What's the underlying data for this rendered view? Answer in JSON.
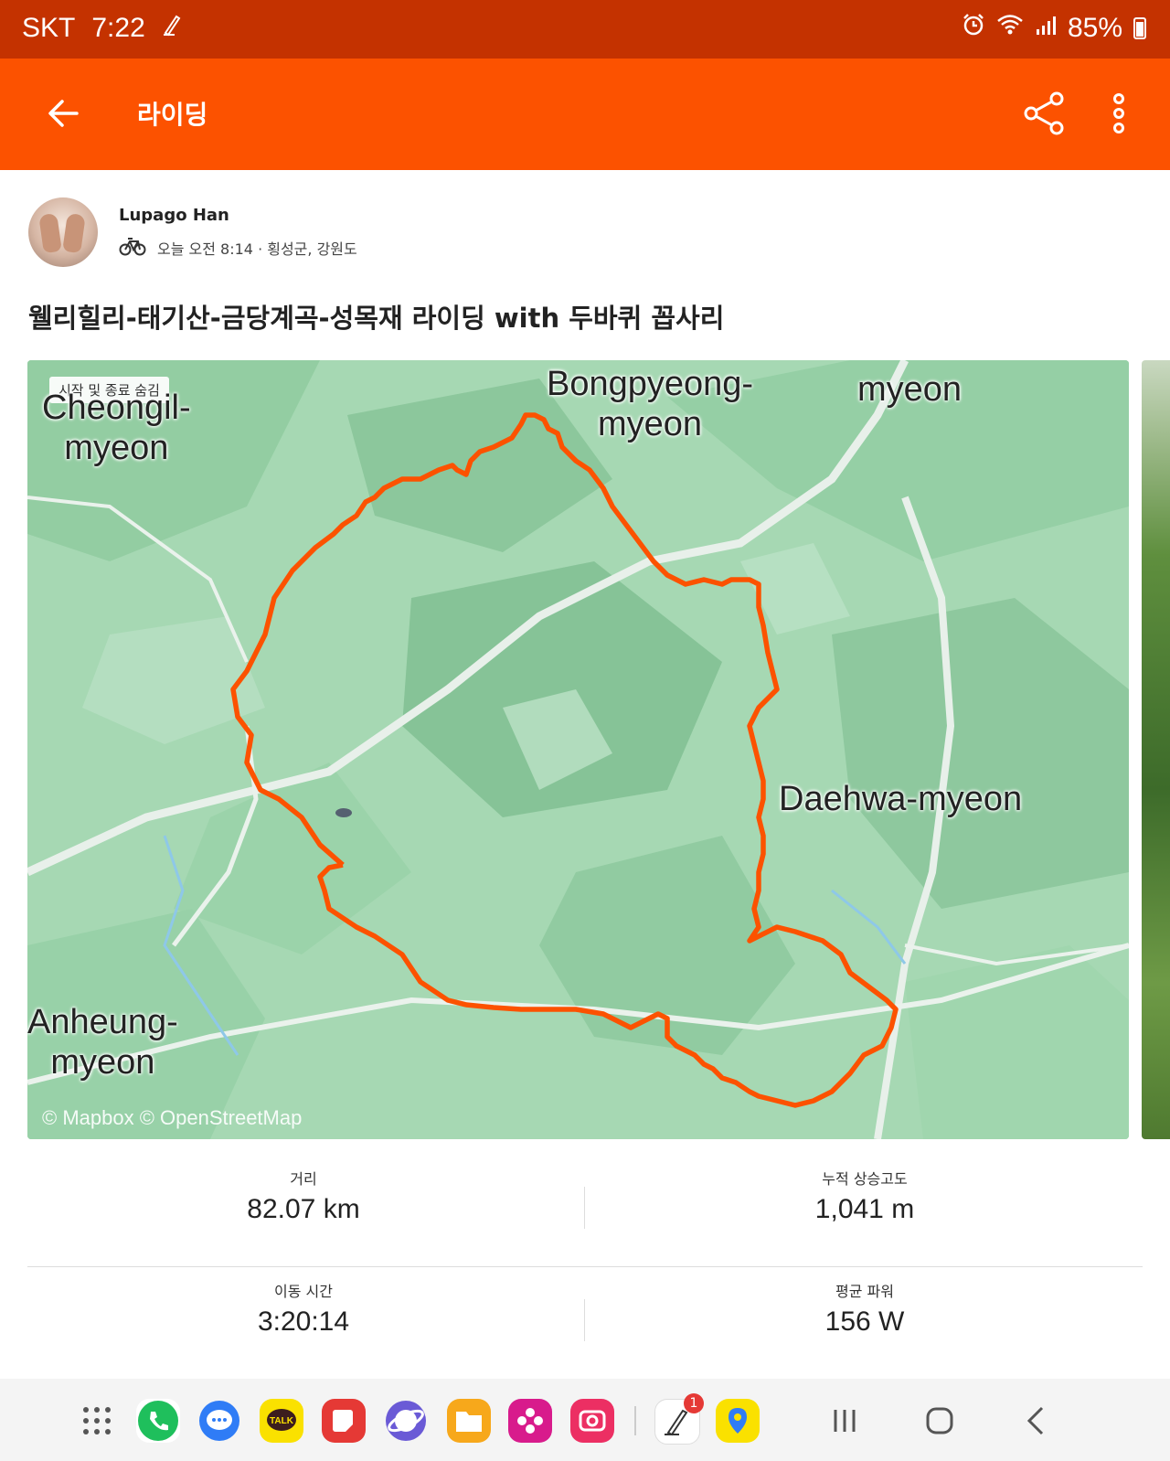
{
  "status_bar": {
    "carrier": "SKT",
    "time": "7:22",
    "battery": "85%"
  },
  "app_bar": {
    "title": "라이딩"
  },
  "activity": {
    "athlete": "Lupago Han",
    "meta": "오늘 오전 8:14 · 횡성군, 강원도",
    "title": "웰리힐리-태기산-금당계곡-성목재 라이딩 with 두바퀴 꼽사리"
  },
  "map": {
    "hide_label": "시작 및 종료 숨김",
    "places": {
      "cheongil_1": "Cheongil-",
      "cheongil_2": "myeon",
      "bongpyeong_1": "Bongpyeong-",
      "bongpyeong_2": "myeon",
      "bongpyeong_top": "myeon",
      "daehwa": "Daehwa-myeon",
      "anheung_1": "Anheung-",
      "anheung_2": "myeon"
    },
    "attribution": "© Mapbox © OpenStreetMap",
    "route_color": "#fc5200"
  },
  "stats": {
    "distance": {
      "label": "거리",
      "value": "82.07 km"
    },
    "elevation": {
      "label": "누적 상승고도",
      "value": "1,041 m"
    },
    "moving_time": {
      "label": "이동 시간",
      "value": "3:20:14"
    },
    "avg_power": {
      "label": "평균 파워",
      "value": "156 W"
    }
  },
  "nav": {
    "notification_badge": "1"
  }
}
